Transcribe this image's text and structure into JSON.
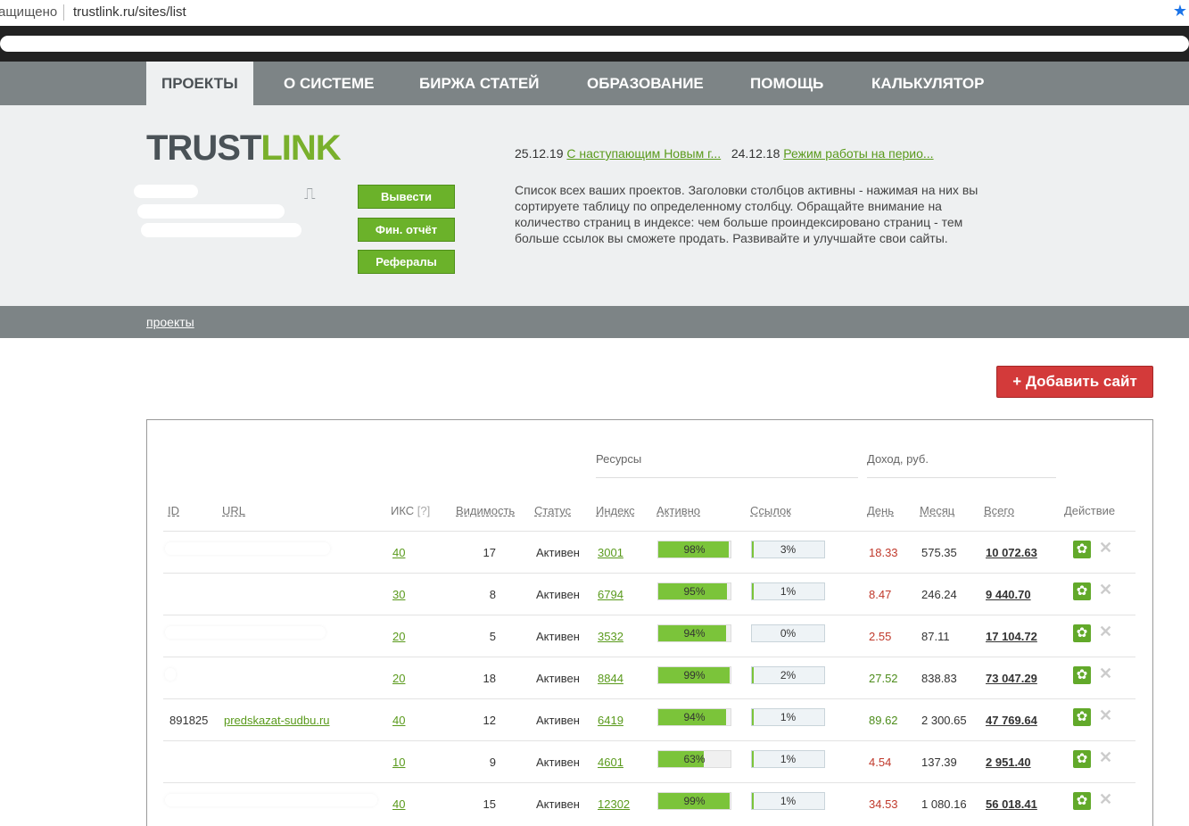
{
  "browser": {
    "secure_label": "ащищено",
    "url": "trustlink.ru/sites/list",
    "star_icon": "star-icon"
  },
  "nav": {
    "items": [
      "ПРОЕКТЫ",
      "О СИСТЕМЕ",
      "БИРЖА СТАТЕЙ",
      "ОБРАЗОВАНИЕ",
      "ПОМОЩЬ",
      "КАЛЬКУЛЯТОР"
    ],
    "active": "ПРОЕКТЫ"
  },
  "logo": {
    "part1": "TRUST",
    "part2": "LINK"
  },
  "account": {
    "buttons": [
      "Вывести",
      "Фин. отчёт",
      "Рефералы"
    ],
    "exit_icon": "exit-icon"
  },
  "news": [
    {
      "date": "25.12.19",
      "title": "С наступающим Новым г..."
    },
    {
      "date": "24.12.18",
      "title": "Режим работы на перио..."
    }
  ],
  "description": "Список всех ваших проектов. Заголовки столбцов активны - нажимая на них вы сортируете таблицу по определенному столбцу. Обращайте внимание на количество страниц в индексе: чем больше проиндексировано страниц - тем больше ссылок вы сможете продать. Развивайте и улучшайте свои сайты.",
  "breadcrumb": "проекты",
  "add_button": "+ Добавить сайт",
  "table": {
    "groups": {
      "resources": "Ресурсы",
      "income": "Доход,  руб."
    },
    "headers": {
      "id": "ID",
      "url": "URL",
      "iks": "ИКС",
      "iks_help": "[?]",
      "visibility": "Видимость",
      "status": "Статус",
      "index": "Индекс",
      "active": "Активно",
      "links": "Ссылок",
      "day": "День",
      "month": "Месяц",
      "total": "Всего",
      "action": "Действие"
    },
    "rows": [
      {
        "id": "",
        "url": "",
        "iks": "40",
        "visibility": "17",
        "status": "Активен",
        "index": "3001",
        "active_pct": 98,
        "active_label": "98%",
        "links_pct": 3,
        "links_label": "3%",
        "day": "18.33",
        "day_color": "red",
        "month": "575.35",
        "total": "10 072.63"
      },
      {
        "id": "",
        "url": "",
        "iks": "30",
        "visibility": "8",
        "status": "Активен",
        "index": "6794",
        "active_pct": 95,
        "active_label": "95%",
        "links_pct": 1,
        "links_label": "1%",
        "day": "8.47",
        "day_color": "red",
        "month": "246.24",
        "total": "9 440.70"
      },
      {
        "id": "",
        "url": "",
        "iks": "20",
        "visibility": "5",
        "status": "Активен",
        "index": "3532",
        "active_pct": 94,
        "active_label": "94%",
        "links_pct": 0,
        "links_label": "0%",
        "day": "2.55",
        "day_color": "red",
        "month": "87.11",
        "total": "17 104.72"
      },
      {
        "id": "",
        "url": "",
        "iks": "20",
        "visibility": "18",
        "status": "Активен",
        "index": "8844",
        "active_pct": 99,
        "active_label": "99%",
        "links_pct": 2,
        "links_label": "2%",
        "day": "27.52",
        "day_color": "green",
        "month": "838.83",
        "total": "73 047.29"
      },
      {
        "id": "891825",
        "url": "predskazat-sudbu.ru",
        "iks": "40",
        "visibility": "12",
        "status": "Активен",
        "index": "6419",
        "active_pct": 94,
        "active_label": "94%",
        "links_pct": 1,
        "links_label": "1%",
        "day": "89.62",
        "day_color": "green",
        "month": "2 300.65",
        "total": "47 769.64"
      },
      {
        "id": "",
        "url": "",
        "iks": "10",
        "visibility": "9",
        "status": "Активен",
        "index": "4601",
        "active_pct": 63,
        "active_label": "63%",
        "links_pct": 1,
        "links_label": "1%",
        "day": "4.54",
        "day_color": "red",
        "month": "137.39",
        "total": "2 951.40"
      },
      {
        "id": "",
        "url": "",
        "iks": "40",
        "visibility": "15",
        "status": "Активен",
        "index": "12302",
        "active_pct": 99,
        "active_label": "99%",
        "links_pct": 1,
        "links_label": "1%",
        "day": "34.53",
        "day_color": "red",
        "month": "1 080.16",
        "total": "56 018.41"
      }
    ]
  }
}
